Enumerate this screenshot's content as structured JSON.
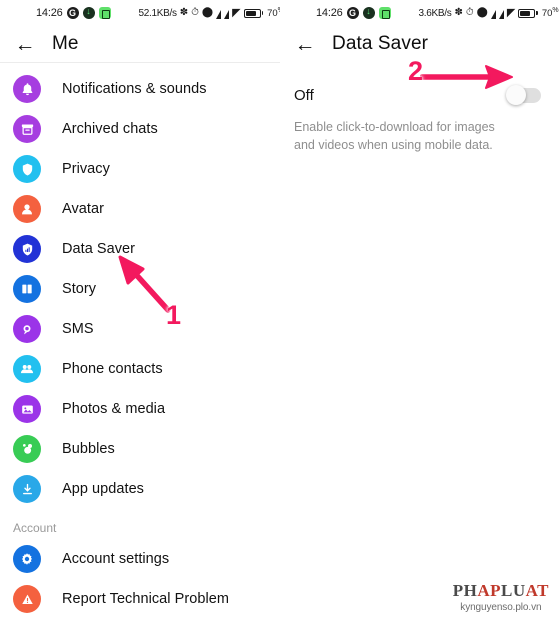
{
  "left": {
    "statusbar": {
      "time": "14:26",
      "speed": "52.1KB/s",
      "battery": "70",
      "battery_suffix": "%"
    },
    "appbar": {
      "title": "Me",
      "back_icon": "arrow-left-icon"
    },
    "items": [
      {
        "label": "Notifications & sounds",
        "icon": "bell-icon",
        "color": "#a63ee0"
      },
      {
        "label": "Archived chats",
        "icon": "archive-box-icon",
        "color": "#a63ee0"
      },
      {
        "label": "Privacy",
        "icon": "shield-icon",
        "color": "#22c0ef"
      },
      {
        "label": "Avatar",
        "icon": "avatar-icon",
        "color": "#f4613f"
      },
      {
        "label": "Data Saver",
        "icon": "shield-data-icon",
        "color": "#2233d6"
      },
      {
        "label": "Story",
        "icon": "book-icon",
        "color": "#1472e0"
      },
      {
        "label": "SMS",
        "icon": "message-circle-icon",
        "color": "#9b34e8"
      },
      {
        "label": "Phone contacts",
        "icon": "contacts-icon",
        "color": "#22c0ef"
      },
      {
        "label": "Photos & media",
        "icon": "photo-icon",
        "color": "#9b34e8"
      },
      {
        "label": "Bubbles",
        "icon": "bubbles-icon",
        "color": "#38cc55"
      },
      {
        "label": "App updates",
        "icon": "download-icon",
        "color": "#29a8e8"
      }
    ],
    "section_account": "Account",
    "account_items": [
      {
        "label": "Account settings",
        "icon": "gear-icon",
        "color": "#1472e0"
      },
      {
        "label": "Report Technical Problem",
        "icon": "warning-triangle-icon",
        "color": "#f4613f"
      }
    ],
    "annotation": {
      "number": "1",
      "arrow": "arrow-up-left-icon",
      "color": "#f3195e"
    }
  },
  "right": {
    "statusbar": {
      "time": "14:26",
      "speed": "3.6KB/s",
      "battery": "70",
      "battery_suffix": "%"
    },
    "appbar": {
      "title": "Data Saver",
      "back_icon": "arrow-left-icon"
    },
    "toggle": {
      "state_label": "Off",
      "checked": false
    },
    "description": "Enable click-to-download for images and videos when using mobile data.",
    "annotation": {
      "number": "2",
      "arrow": "arrow-right-icon",
      "color": "#f3195e"
    },
    "watermark": {
      "logo_a": "PH",
      "logo_b": "AP",
      "logo_c": "LU",
      "logo_d": "AT",
      "url": "kynguyenso.plo.vn"
    }
  }
}
